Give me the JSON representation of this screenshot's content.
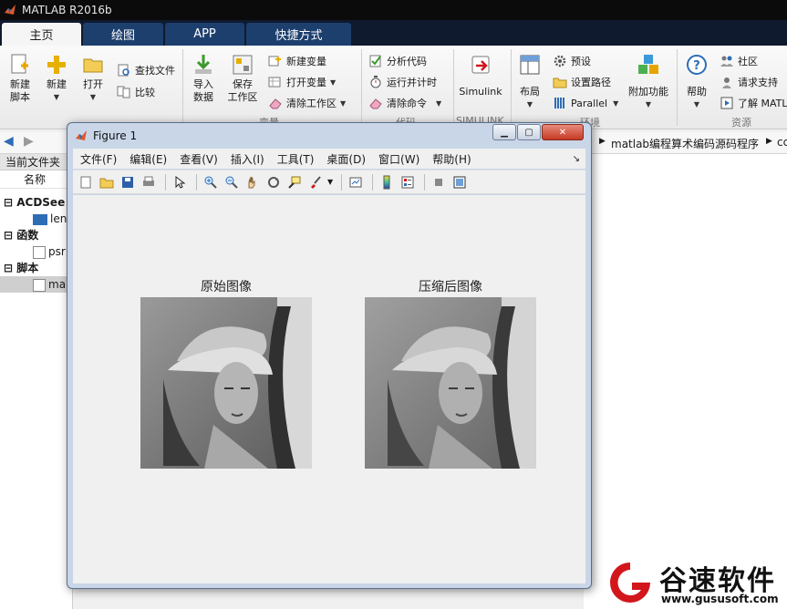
{
  "app": {
    "title": "MATLAB R2016b"
  },
  "tabs": [
    {
      "label": "主页",
      "active": true
    },
    {
      "label": "绘图",
      "active": false
    },
    {
      "label": "APP",
      "active": false
    },
    {
      "label": "快捷方式",
      "active": false
    }
  ],
  "ribbon": {
    "new_script": "新建\n脚本",
    "new": "新建",
    "open": "打开",
    "find_files": "查找文件",
    "compare": "比较",
    "import_data": "导入\n数据",
    "save_workspace": "保存\n工作区",
    "new_variable": "新建变量",
    "open_variable": "打开变量",
    "clear_workspace": "清除工作区",
    "analyze_code": "分析代码",
    "run_and_time": "运行并计时",
    "clear_commands": "清除命令",
    "simulink": "Simulink",
    "layout": "布局",
    "preferences": "预设",
    "set_path": "设置路径",
    "parallel": "Parallel",
    "add_ons": "附加功能",
    "help": "帮助",
    "community": "社区",
    "request_support": "请求支持",
    "learn_matlab": "了解 MATL",
    "group_labels": [
      "变量",
      "代码",
      "SIMULINK",
      "环境",
      "资源"
    ]
  },
  "address": {
    "path_segment": "matlab编程算术编码源码程序",
    "path_tail": "cc"
  },
  "left_panel": {
    "header": "当前文件夹",
    "column": "名称",
    "groups": [
      {
        "label": "ACDSee",
        "items": [
          "len"
        ]
      },
      {
        "label": "函数",
        "items": [
          "psr"
        ]
      },
      {
        "label": "脚本",
        "items": [
          "ma"
        ]
      }
    ]
  },
  "figure": {
    "title": "Figure 1",
    "menu": [
      "文件(F)",
      "编辑(E)",
      "查看(V)",
      "插入(I)",
      "工具(T)",
      "桌面(D)",
      "窗口(W)",
      "帮助(H)"
    ],
    "images": [
      {
        "title": "原始图像"
      },
      {
        "title": "压缩后图像"
      }
    ]
  },
  "watermark": {
    "name": "谷速软件",
    "url": "www.gususoft.com"
  },
  "colors": {
    "accent_tab": "#1d3f6e",
    "dark_bar": "#0b0b0b",
    "watermark_red": "#d2161c"
  }
}
